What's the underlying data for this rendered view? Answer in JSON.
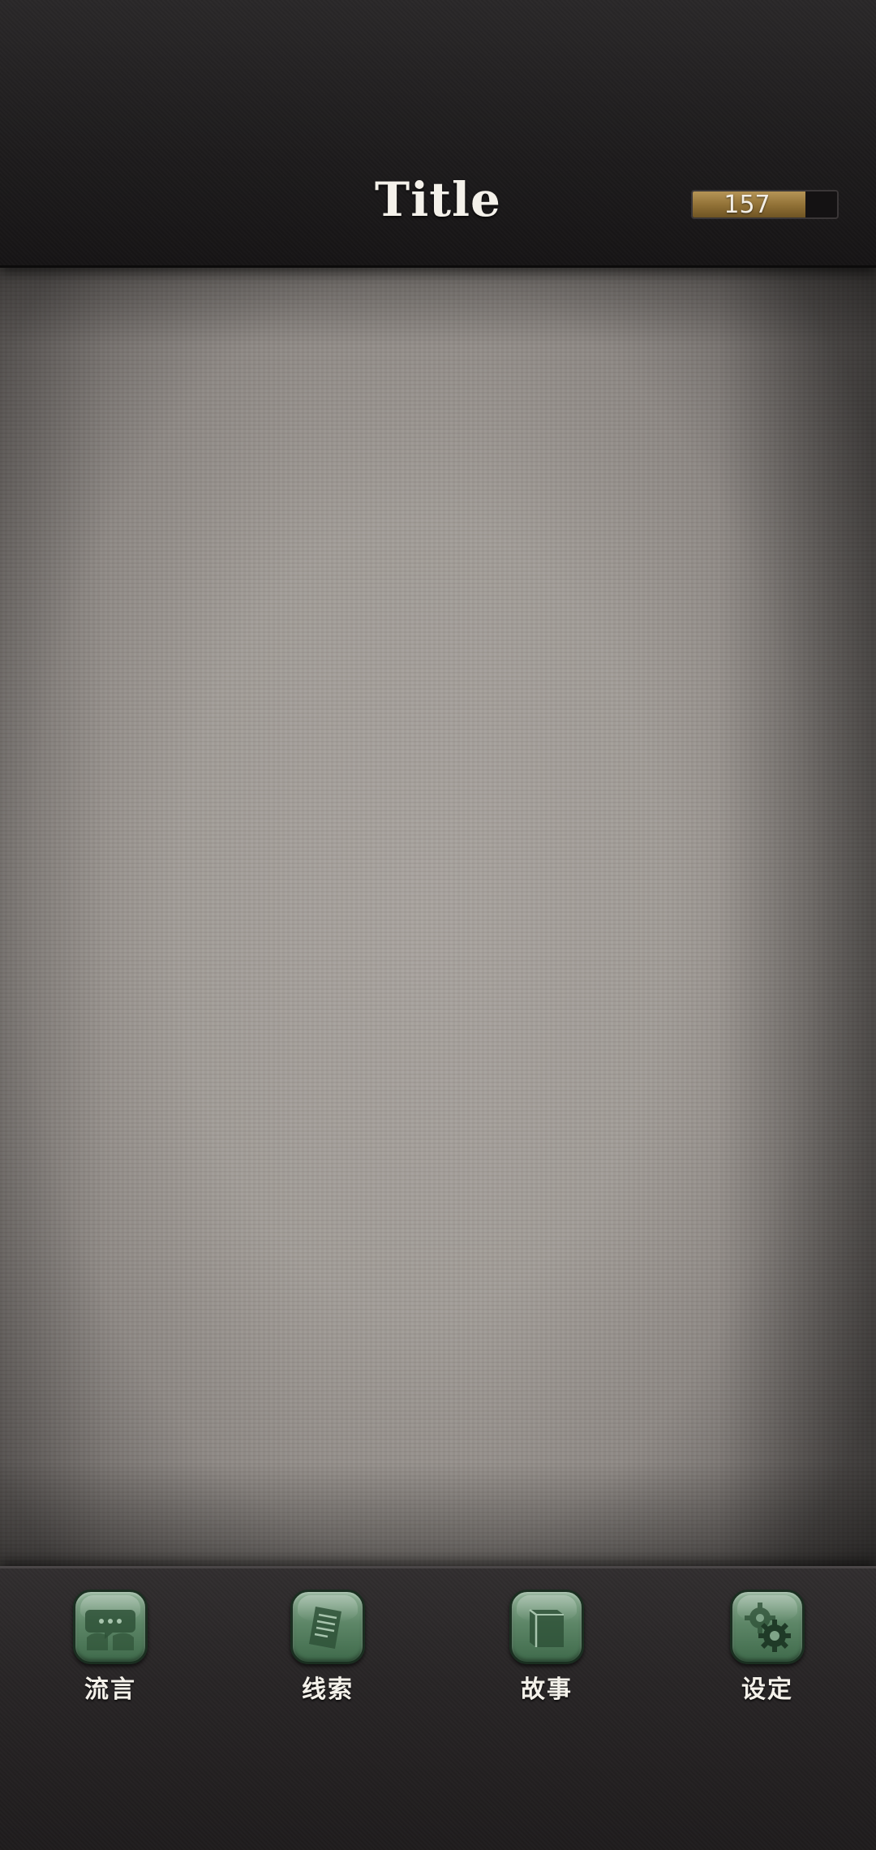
{
  "header": {
    "title": "Title",
    "counter": {
      "value": "157",
      "fill_fraction": 0.78
    }
  },
  "colors": {
    "header_bg": "#1d1b1c",
    "parchment": "#a29d98",
    "progress_fill": "#9a7b3f",
    "icon_green": "#5d8667",
    "label_text": "#f4f1ea"
  },
  "nav": {
    "items": [
      {
        "label": "流言",
        "icon": "speech-bubbles-icon"
      },
      {
        "label": "线索",
        "icon": "document-icon"
      },
      {
        "label": "故事",
        "icon": "book-icon"
      },
      {
        "label": "设定",
        "icon": "gears-icon"
      }
    ]
  }
}
